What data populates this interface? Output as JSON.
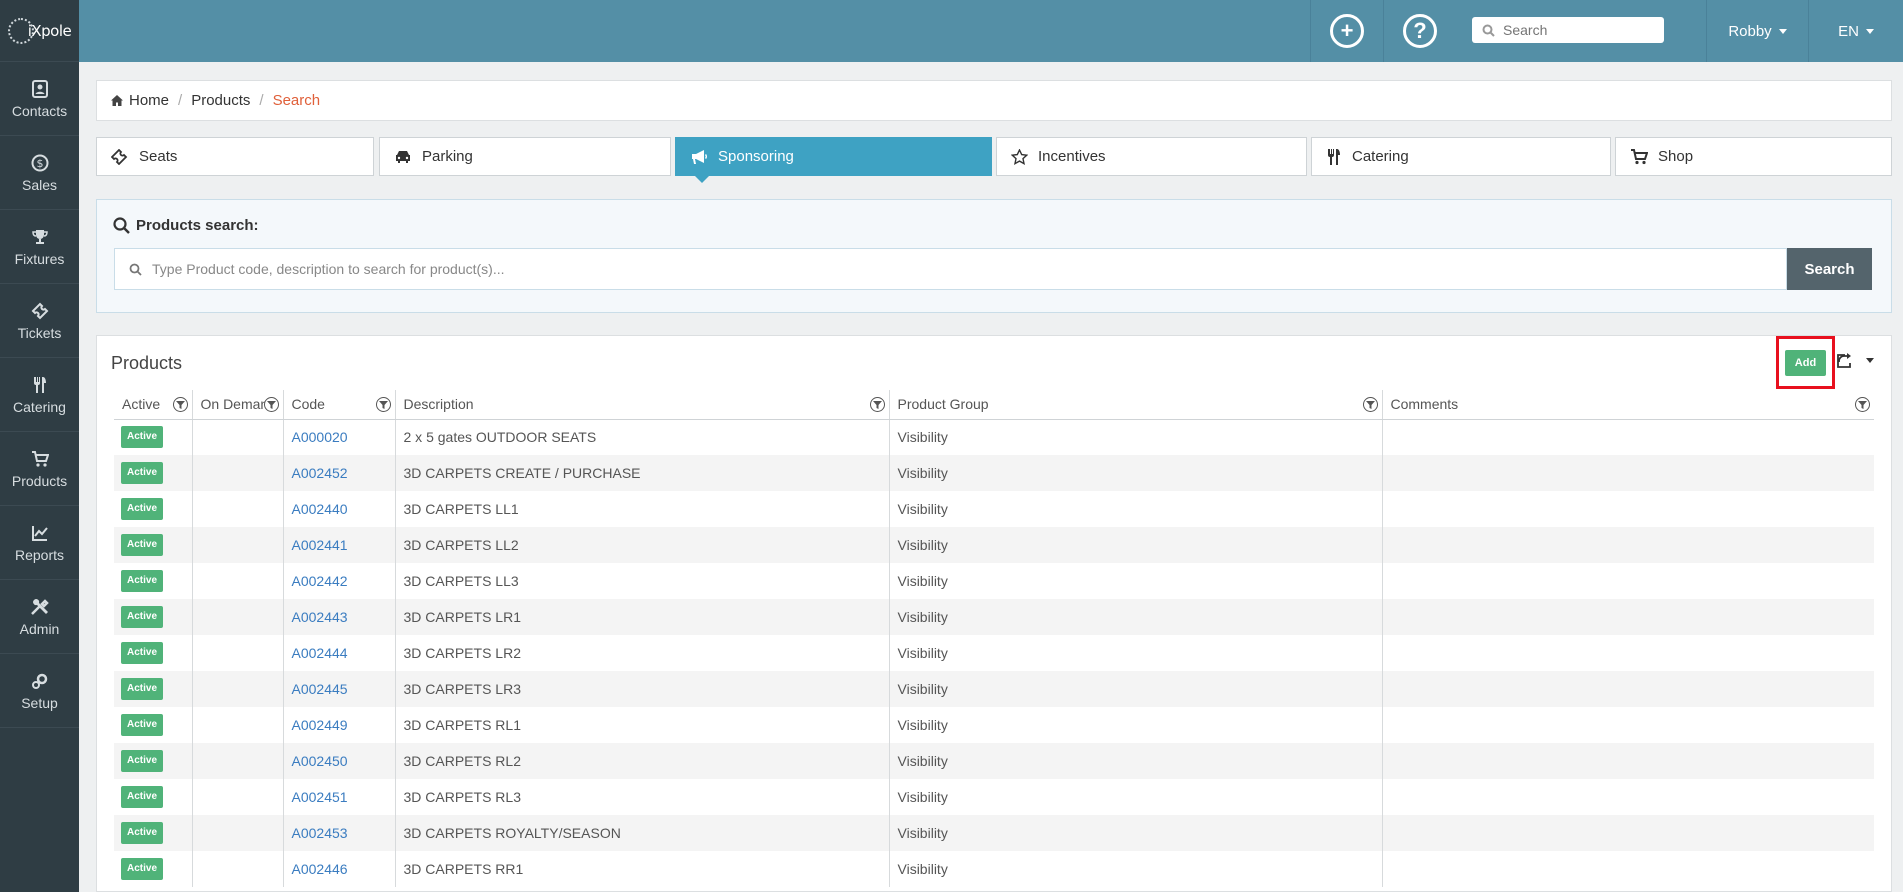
{
  "sidebar": {
    "logo": "iXpole",
    "items": [
      {
        "label": "Contacts",
        "icon": "contacts-icon"
      },
      {
        "label": "Sales",
        "icon": "sales-icon"
      },
      {
        "label": "Fixtures",
        "icon": "fixtures-icon"
      },
      {
        "label": "Tickets",
        "icon": "tickets-icon"
      },
      {
        "label": "Catering",
        "icon": "catering-icon"
      },
      {
        "label": "Products",
        "icon": "products-icon"
      },
      {
        "label": "Reports",
        "icon": "reports-icon"
      },
      {
        "label": "Admin",
        "icon": "admin-icon"
      },
      {
        "label": "Setup",
        "icon": "setup-icon"
      }
    ]
  },
  "topbar": {
    "search_placeholder": "Search",
    "user": "Robby",
    "lang": "EN"
  },
  "breadcrumb": {
    "home": "Home",
    "products": "Products",
    "current": "Search"
  },
  "tabs": [
    {
      "label": "Seats",
      "icon": "ticket-icon",
      "active": false
    },
    {
      "label": "Parking",
      "icon": "car-icon",
      "active": false
    },
    {
      "label": "Sponsoring",
      "icon": "megaphone-icon",
      "active": true
    },
    {
      "label": "Incentives",
      "icon": "star-icon",
      "active": false
    },
    {
      "label": "Catering",
      "icon": "cutlery-icon",
      "active": false
    },
    {
      "label": "Shop",
      "icon": "cart-icon",
      "active": false
    }
  ],
  "search_panel": {
    "title": "Products search:",
    "placeholder": "Type Product code, description to search for product(s)...",
    "button": "Search"
  },
  "products": {
    "title": "Products",
    "add_label": "Add",
    "columns": [
      "Active",
      "On Demand",
      "Code",
      "Description",
      "Product Group",
      "Comments"
    ],
    "rows": [
      {
        "status": "Active",
        "code": "A000020",
        "description": "2 x 5 gates OUTDOOR SEATS",
        "group": "Visibility"
      },
      {
        "status": "Active",
        "code": "A002452",
        "description": "3D CARPETS CREATE / PURCHASE",
        "group": "Visibility"
      },
      {
        "status": "Active",
        "code": "A002440",
        "description": "3D CARPETS LL1",
        "group": "Visibility"
      },
      {
        "status": "Active",
        "code": "A002441",
        "description": "3D CARPETS LL2",
        "group": "Visibility"
      },
      {
        "status": "Active",
        "code": "A002442",
        "description": "3D CARPETS LL3",
        "group": "Visibility"
      },
      {
        "status": "Active",
        "code": "A002443",
        "description": "3D CARPETS LR1",
        "group": "Visibility"
      },
      {
        "status": "Active",
        "code": "A002444",
        "description": "3D CARPETS LR2",
        "group": "Visibility"
      },
      {
        "status": "Active",
        "code": "A002445",
        "description": "3D CARPETS LR3",
        "group": "Visibility"
      },
      {
        "status": "Active",
        "code": "A002449",
        "description": "3D CARPETS RL1",
        "group": "Visibility"
      },
      {
        "status": "Active",
        "code": "A002450",
        "description": "3D CARPETS RL2",
        "group": "Visibility"
      },
      {
        "status": "Active",
        "code": "A002451",
        "description": "3D CARPETS RL3",
        "group": "Visibility"
      },
      {
        "status": "Active",
        "code": "A002453",
        "description": "3D CARPETS ROYALTY/SEASON",
        "group": "Visibility"
      },
      {
        "status": "Active",
        "code": "A002446",
        "description": "3D CARPETS RR1",
        "group": "Visibility"
      }
    ]
  },
  "colors": {
    "topbar": "#548fa6",
    "sidebar": "#2f3d44",
    "active_tab": "#3ea2c3",
    "status_green": "#50b379",
    "highlight": "#e8101e",
    "link": "#3a7cc0",
    "breadcrumb_active": "#e0603a"
  }
}
